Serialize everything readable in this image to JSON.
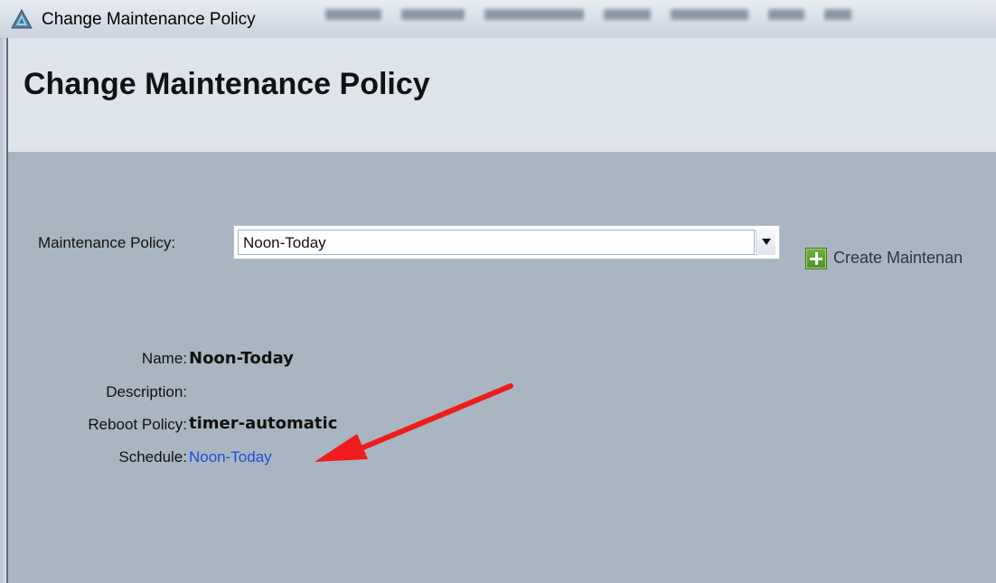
{
  "window": {
    "title": "Change Maintenance Policy"
  },
  "header": {
    "title": "Change Maintenance Policy"
  },
  "form": {
    "policy_label": "Maintenance Policy:",
    "policy_value": "Noon-Today",
    "create_label": "Create Maintenan"
  },
  "details": {
    "name_label": "Name:",
    "name_value": "Noon-Today",
    "description_label": "Description:",
    "reboot_label": "Reboot Policy:",
    "reboot_value": "timer-automatic",
    "schedule_label": "Schedule:",
    "schedule_value": "Noon-Today"
  },
  "icons": {
    "app": "triangle-logo-icon",
    "create": "plus-icon",
    "dropdown": "chevron-down-icon",
    "annotation": "red-arrow-icon"
  },
  "colors": {
    "link": "#1d4ed8",
    "annotation_arrow": "#ee1c1c",
    "content_bg": "#a9b5c1",
    "header_bg": "#dde4ec",
    "plus_icon": "#5a9a2a"
  }
}
